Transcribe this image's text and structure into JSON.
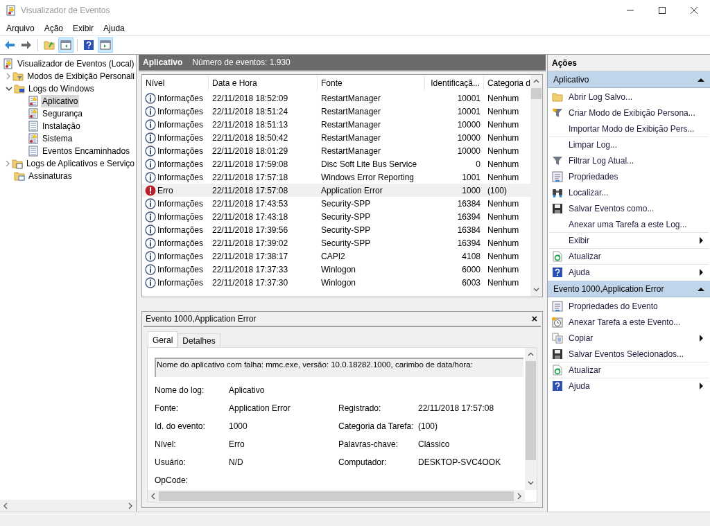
{
  "window": {
    "title": "Visualizador de Eventos"
  },
  "menu": [
    "Arquivo",
    "Ação",
    "Exibir",
    "Ajuda"
  ],
  "toolbar": [
    {
      "kind": "back",
      "selected": false
    },
    {
      "kind": "forward",
      "selected": false
    },
    {
      "kind": "folder-up",
      "selected": false
    },
    {
      "kind": "pane-left",
      "selected": true
    },
    {
      "kind": "help",
      "selected": false
    },
    {
      "kind": "pane-right",
      "selected": true
    }
  ],
  "tree": [
    {
      "label": "Visualizador de Eventos (Local)",
      "kind": "root",
      "selected": false,
      "children": [
        {
          "label": "Modos de Exibição Personali",
          "kind": "folder",
          "expanded": false,
          "selected": false
        },
        {
          "label": "Logs do Windows",
          "kind": "folder",
          "expanded": true,
          "selected": false,
          "children": [
            {
              "label": "Aplicativo",
              "kind": "alertlog",
              "selected": true
            },
            {
              "label": "Segurança",
              "kind": "alertlog",
              "selected": false
            },
            {
              "label": "Instalação",
              "kind": "log",
              "selected": false
            },
            {
              "label": "Sistema",
              "kind": "alertlog",
              "selected": false
            },
            {
              "label": "Eventos Encaminhados",
              "kind": "log",
              "selected": false
            }
          ]
        },
        {
          "label": "Logs de Aplicativos e Serviço",
          "kind": "folder",
          "expanded": false,
          "selected": false
        },
        {
          "label": "Assinaturas",
          "kind": "folder",
          "selected": false
        }
      ]
    }
  ],
  "log": {
    "title": "Aplicativo",
    "count": "Número de eventos: 1.930",
    "columns": [
      "Nível",
      "Data e Hora",
      "Fonte",
      "Identificaçã...",
      "Categoria d"
    ],
    "rows": [
      {
        "kind": "info",
        "level": "Informações",
        "date": "22/11/2018 18:52:09",
        "source": "RestartManager",
        "id": "10001",
        "category": "Nenhum",
        "selected": false
      },
      {
        "kind": "info",
        "level": "Informações",
        "date": "22/11/2018 18:51:24",
        "source": "RestartManager",
        "id": "10001",
        "category": "Nenhum",
        "selected": false
      },
      {
        "kind": "info",
        "level": "Informações",
        "date": "22/11/2018 18:51:13",
        "source": "RestartManager",
        "id": "10000",
        "category": "Nenhum",
        "selected": false
      },
      {
        "kind": "info",
        "level": "Informações",
        "date": "22/11/2018 18:50:42",
        "source": "RestartManager",
        "id": "10000",
        "category": "Nenhum",
        "selected": false
      },
      {
        "kind": "info",
        "level": "Informações",
        "date": "22/11/2018 18:01:29",
        "source": "RestartManager",
        "id": "10000",
        "category": "Nenhum",
        "selected": false
      },
      {
        "kind": "info",
        "level": "Informações",
        "date": "22/11/2018 17:59:08",
        "source": "Disc Soft Lite Bus Service",
        "id": "0",
        "category": "Nenhum",
        "selected": false
      },
      {
        "kind": "info",
        "level": "Informações",
        "date": "22/11/2018 17:57:18",
        "source": "Windows Error Reporting",
        "id": "1001",
        "category": "Nenhum",
        "selected": false
      },
      {
        "kind": "error",
        "level": "Erro",
        "date": "22/11/2018 17:57:08",
        "source": "Application Error",
        "id": "1000",
        "category": "(100)",
        "selected": true
      },
      {
        "kind": "info",
        "level": "Informações",
        "date": "22/11/2018 17:43:53",
        "source": "Security-SPP",
        "id": "16384",
        "category": "Nenhum",
        "selected": false
      },
      {
        "kind": "info",
        "level": "Informações",
        "date": "22/11/2018 17:43:18",
        "source": "Security-SPP",
        "id": "16394",
        "category": "Nenhum",
        "selected": false
      },
      {
        "kind": "info",
        "level": "Informações",
        "date": "22/11/2018 17:39:56",
        "source": "Security-SPP",
        "id": "16384",
        "category": "Nenhum",
        "selected": false
      },
      {
        "kind": "info",
        "level": "Informações",
        "date": "22/11/2018 17:39:02",
        "source": "Security-SPP",
        "id": "16394",
        "category": "Nenhum",
        "selected": false
      },
      {
        "kind": "info",
        "level": "Informações",
        "date": "22/11/2018 17:38:17",
        "source": "CAPI2",
        "id": "4108",
        "category": "Nenhum",
        "selected": false
      },
      {
        "kind": "info",
        "level": "Informações",
        "date": "22/11/2018 17:37:33",
        "source": "Winlogon",
        "id": "6000",
        "category": "Nenhum",
        "selected": false
      },
      {
        "kind": "info",
        "level": "Informações",
        "date": "22/11/2018 17:37:30",
        "source": "Winlogon",
        "id": "6003",
        "category": "Nenhum",
        "selected": false
      }
    ]
  },
  "detail": {
    "title": "Evento 1000,Application Error",
    "close": "×",
    "tabs": [
      {
        "label": "Geral",
        "selected": true
      },
      {
        "label": "Detalhes",
        "selected": false
      }
    ],
    "description": "Nome do aplicativo com falha: mmc.exe, versão: 10.0.18282.1000, carimbo de data/hora:",
    "fields": [
      {
        "label": "Nome do log:",
        "value": "Aplicativo"
      },
      {
        "label": "Fonte:",
        "value": "Application Error",
        "label2": "Registrado:",
        "value2": "22/11/2018 17:57:08"
      },
      {
        "label": "Id. do evento:",
        "value": "1000",
        "label2": "Categoria da Tarefa:",
        "value2": "(100)"
      },
      {
        "label": "Nível:",
        "value": "Erro",
        "label2": "Palavras-chave:",
        "value2": "Clássico"
      },
      {
        "label": "Usuário:",
        "value": "N/D",
        "label2": "Computador:",
        "value2": "DESKTOP-SVC4OOK"
      },
      {
        "label": "OpCode:"
      }
    ]
  },
  "actions": {
    "title": "Ações",
    "sections": [
      {
        "title": "Aplicativo",
        "expanded": true,
        "items": [
          {
            "kind": "open",
            "label": "Abrir Log Salvo...",
            "submenu": false,
            "divider": false
          },
          {
            "kind": "create",
            "label": "Criar Modo de Exibição Persona...",
            "submenu": false,
            "divider": false
          },
          {
            "kind": "plain",
            "label": "Importar Modo de Exibição Pers...",
            "submenu": false,
            "divider": false
          },
          {
            "kind": "plain",
            "label": "Limpar Log...",
            "submenu": false,
            "divider": true
          },
          {
            "kind": "filter",
            "label": "Filtrar Log Atual...",
            "submenu": false,
            "divider": false
          },
          {
            "kind": "properties",
            "label": "Propriedades",
            "submenu": false,
            "divider": false
          },
          {
            "kind": "find",
            "label": "Localizar...",
            "submenu": false,
            "divider": false
          },
          {
            "kind": "save",
            "label": "Salvar Eventos como...",
            "submenu": false,
            "divider": false
          },
          {
            "kind": "plain",
            "label": "Anexar uma Tarefa a este Log...",
            "submenu": false,
            "divider": false
          },
          {
            "kind": "plain",
            "label": "Exibir",
            "submenu": true,
            "divider": true
          },
          {
            "kind": "refresh",
            "label": "Atualizar",
            "submenu": false,
            "divider": true
          },
          {
            "kind": "help",
            "label": "Ajuda",
            "submenu": true,
            "divider": true
          }
        ]
      },
      {
        "title": "Evento 1000,Application Error",
        "expanded": true,
        "items": [
          {
            "kind": "properties",
            "label": "Propriedades do Evento",
            "submenu": false,
            "divider": false
          },
          {
            "kind": "task",
            "label": "Anexar Tarefa a este Evento...",
            "submenu": false,
            "divider": false
          },
          {
            "kind": "copy",
            "label": "Copiar",
            "submenu": true,
            "divider": false
          },
          {
            "kind": "save",
            "label": "Salvar Eventos Selecionados...",
            "submenu": false,
            "divider": false
          },
          {
            "kind": "refresh",
            "label": "Atualizar",
            "submenu": false,
            "divider": true
          },
          {
            "kind": "help",
            "label": "Ajuda",
            "submenu": true,
            "divider": true
          }
        ]
      }
    ]
  }
}
